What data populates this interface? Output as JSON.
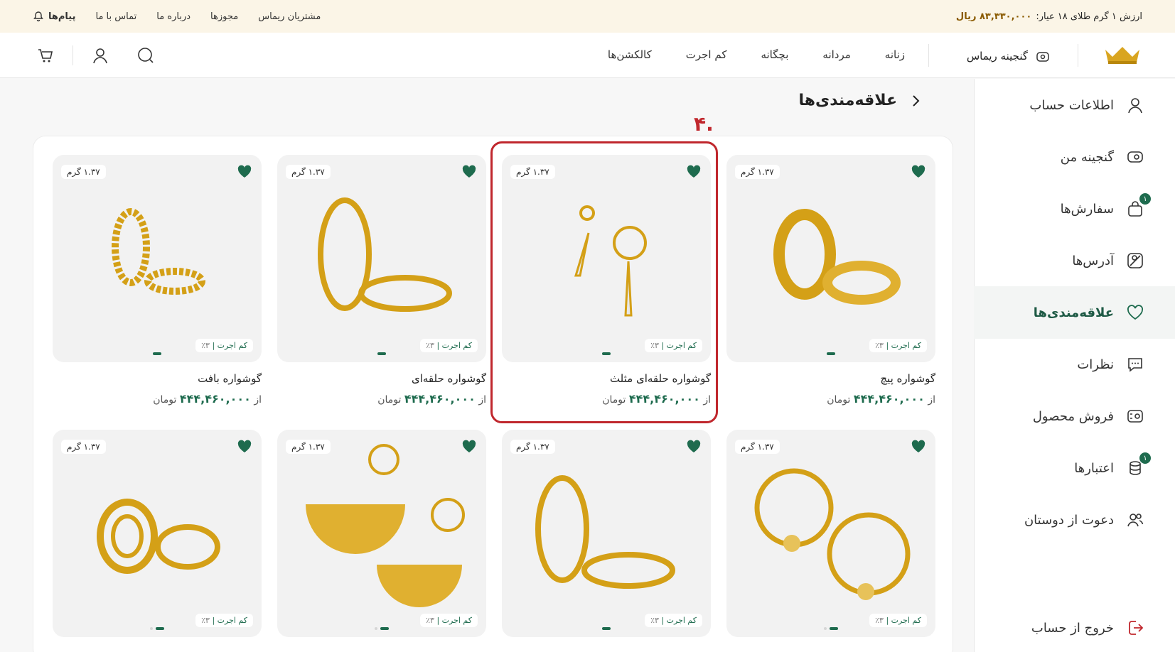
{
  "topbar": {
    "gold_label": "ارزش ۱ گرم طلای ۱۸ عیار:",
    "gold_value": "۸۳,۳۳۰,۰۰۰ ریال",
    "links": [
      "مشتریان ریماس",
      "مجوزها",
      "درباره ما",
      "تماس با ما"
    ],
    "messages": "پیام‌ها"
  },
  "header": {
    "ganjine": "گنجینه ریماس",
    "nav": [
      "زنانه",
      "مردانه",
      "بچگانه",
      "کم اجرت",
      "کالکشن‌ها"
    ]
  },
  "sidebar": {
    "items": [
      {
        "label": "اطلاعات حساب",
        "icon": "user-icon"
      },
      {
        "label": "گنجینه من",
        "icon": "treasure-icon"
      },
      {
        "label": "سفارش‌ها",
        "icon": "bag-icon",
        "badge": "۱"
      },
      {
        "label": "آدرس‌ها",
        "icon": "map-icon"
      },
      {
        "label": "علاقه‌مندی‌ها",
        "icon": "heart-icon",
        "active": true
      },
      {
        "label": "نظرات",
        "icon": "comment-icon"
      },
      {
        "label": "فروش محصول",
        "icon": "sell-icon"
      },
      {
        "label": "اعتبارها",
        "icon": "coins-icon",
        "badge": "۱"
      },
      {
        "label": "دعوت از دوستان",
        "icon": "friends-icon"
      }
    ],
    "logout": "خروج از حساب"
  },
  "page": {
    "title": "علاقه‌مندی‌ها",
    "annotation": ".۴"
  },
  "card_common": {
    "weight": "۱.۳۷ گرم",
    "fee_label": "کم اجرت",
    "fee_value": "۳٪",
    "price_prefix": "از",
    "price_value": "۴۴۴,۴۶۰,۰۰۰",
    "price_unit": "تومان"
  },
  "cards": [
    {
      "name": "گوشواره پیچ"
    },
    {
      "name": "گوشواره حلقه‌ای مثلث"
    },
    {
      "name": "گوشواره حلقه‌ای"
    },
    {
      "name": "گوشواره بافت"
    }
  ],
  "colors": {
    "brand_green": "#1e6b4e",
    "gold": "#c9961a",
    "highlight_red": "#c0272d"
  }
}
